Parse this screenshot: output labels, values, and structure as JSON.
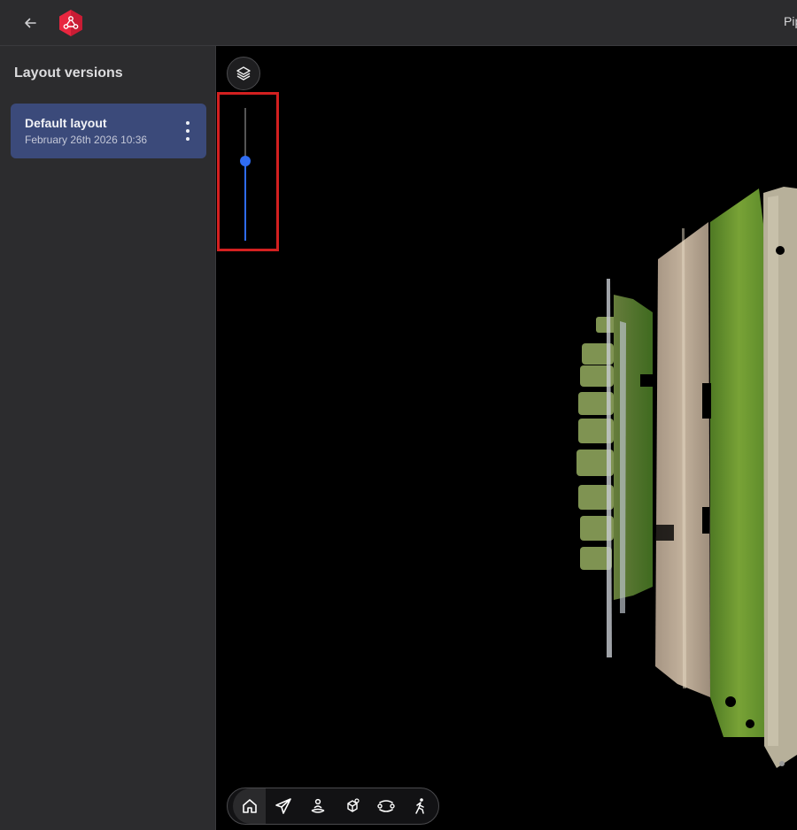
{
  "header": {
    "back_icon": "arrow-left-icon",
    "logo_icon": "app-logo-icon",
    "project_name": "Pip",
    "brand_color": "#e8263f"
  },
  "sidebar": {
    "title": "Layout versions",
    "layouts": [
      {
        "name": "Default layout",
        "date": "February 26th 2026 10:36",
        "selected": true
      }
    ],
    "menu_icon": "more-vertical-icon",
    "selected_color": "#3b4a7a"
  },
  "viewer": {
    "layers_icon": "layers-icon",
    "elevation_slider": {
      "value": 0.6,
      "accent_color": "#2f6cf3",
      "highlighted": true,
      "highlight_color": "#d32020"
    },
    "toolbar": {
      "tools": [
        {
          "icon": "home-icon",
          "active": true
        },
        {
          "icon": "paper-plane-icon",
          "active": false
        },
        {
          "icon": "person-pin-icon",
          "active": false
        },
        {
          "icon": "package-pin-icon",
          "active": false
        },
        {
          "icon": "orbit-path-icon",
          "active": false
        },
        {
          "icon": "walk-icon",
          "active": false
        }
      ]
    }
  }
}
